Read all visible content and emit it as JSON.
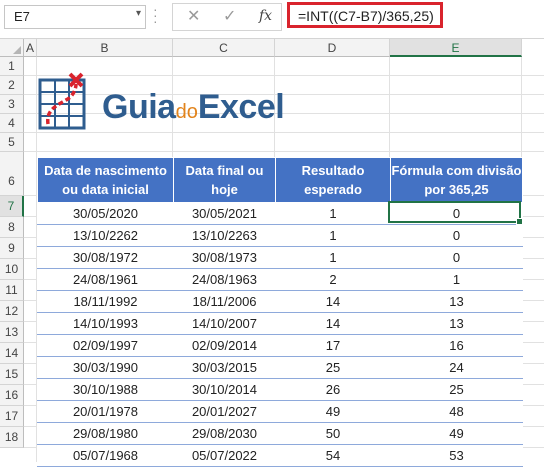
{
  "name_box": {
    "value": "E7"
  },
  "formula_bar": {
    "cancel_icon": "x-icon",
    "enter_icon": "check-icon",
    "fx_label": "fx",
    "formula": "=INT((C7-B7)/365,25)"
  },
  "columns": [
    "A",
    "B",
    "C",
    "D",
    "E"
  ],
  "rows": [
    "1",
    "2",
    "3",
    "4",
    "5",
    "6",
    "7",
    "8",
    "9",
    "10",
    "11",
    "12",
    "13",
    "14",
    "15",
    "16",
    "17",
    "18"
  ],
  "logo": {
    "main": "Guia",
    "mid": "do",
    "tail": "Excel"
  },
  "table": {
    "headers": [
      "Data de nascimento ou data inicial",
      "Data final ou hoje",
      "Resultado esperado",
      "Fórmula com divisão por 365,25"
    ],
    "rows": [
      [
        "30/05/2020",
        "30/05/2021",
        "1",
        "0"
      ],
      [
        "13/10/2262",
        "13/10/2263",
        "1",
        "0"
      ],
      [
        "30/08/1972",
        "30/08/1973",
        "1",
        "0"
      ],
      [
        "24/08/1961",
        "24/08/1963",
        "2",
        "1"
      ],
      [
        "18/11/1992",
        "18/11/2006",
        "14",
        "13"
      ],
      [
        "14/10/1993",
        "14/10/2007",
        "14",
        "13"
      ],
      [
        "02/09/1997",
        "02/09/2014",
        "17",
        "16"
      ],
      [
        "30/03/1990",
        "30/03/2015",
        "25",
        "24"
      ],
      [
        "30/10/1988",
        "30/10/2014",
        "26",
        "25"
      ],
      [
        "20/01/1978",
        "20/01/2027",
        "49",
        "48"
      ],
      [
        "29/08/1980",
        "29/08/2030",
        "50",
        "49"
      ],
      [
        "05/07/1968",
        "05/07/2022",
        "54",
        "53"
      ]
    ]
  },
  "colors": {
    "header_fill": "#4472c4",
    "selection": "#217346",
    "formula_highlight": "#d9232d"
  }
}
